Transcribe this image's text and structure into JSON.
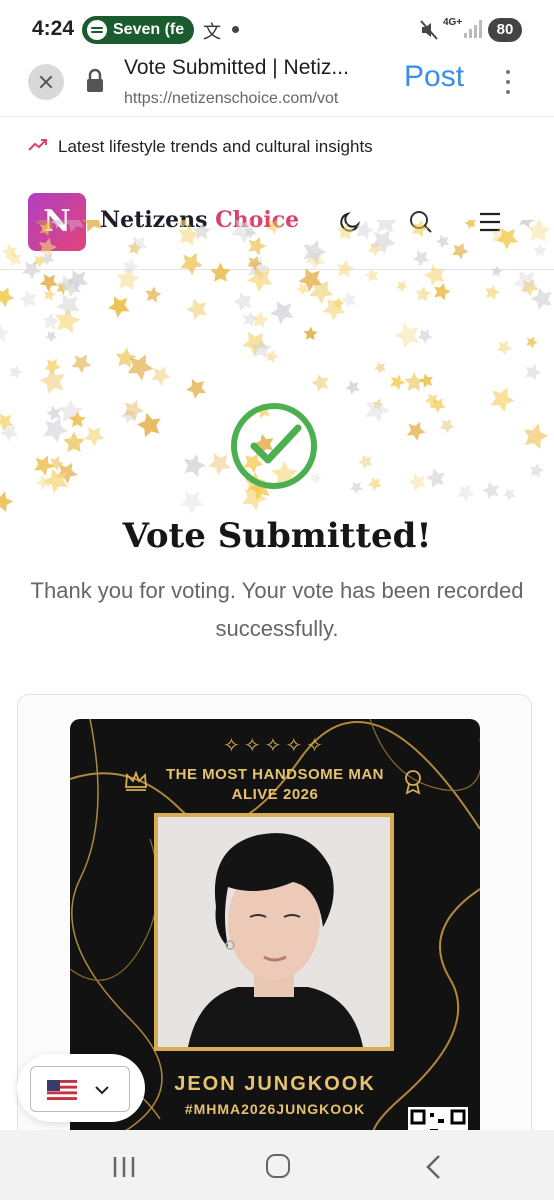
{
  "status_bar": {
    "time": "4:24",
    "spotify_text": "Seven (fe",
    "network": "4G+",
    "battery": "80"
  },
  "browser": {
    "page_title": "Vote Submitted | Netiz...",
    "url": "https://netizenschoice.com/vot",
    "post_label": "Post"
  },
  "trend_bar": {
    "text": "Latest lifestyle trends and cultural insights"
  },
  "header": {
    "logo_letter": "N",
    "brand_part1": "Netizens ",
    "brand_part2": "Choice"
  },
  "success": {
    "title": "Vote Submitted!",
    "message": "Thank you for voting. Your vote has been recorded successfully."
  },
  "poster": {
    "sparkles": "✧✧✧✧✧",
    "title_line1": "THE MOST HANDSOME MAN",
    "title_line2": "ALIVE 2026",
    "name": "JEON JUNGKOOK",
    "hashtag": "#MHMA2026JUNGKOOK"
  },
  "colors": {
    "accent_blue": "#3a8ee6",
    "brand_pink": "#d8436f",
    "check_green": "#4caf50",
    "gold": "#d4ad55"
  }
}
